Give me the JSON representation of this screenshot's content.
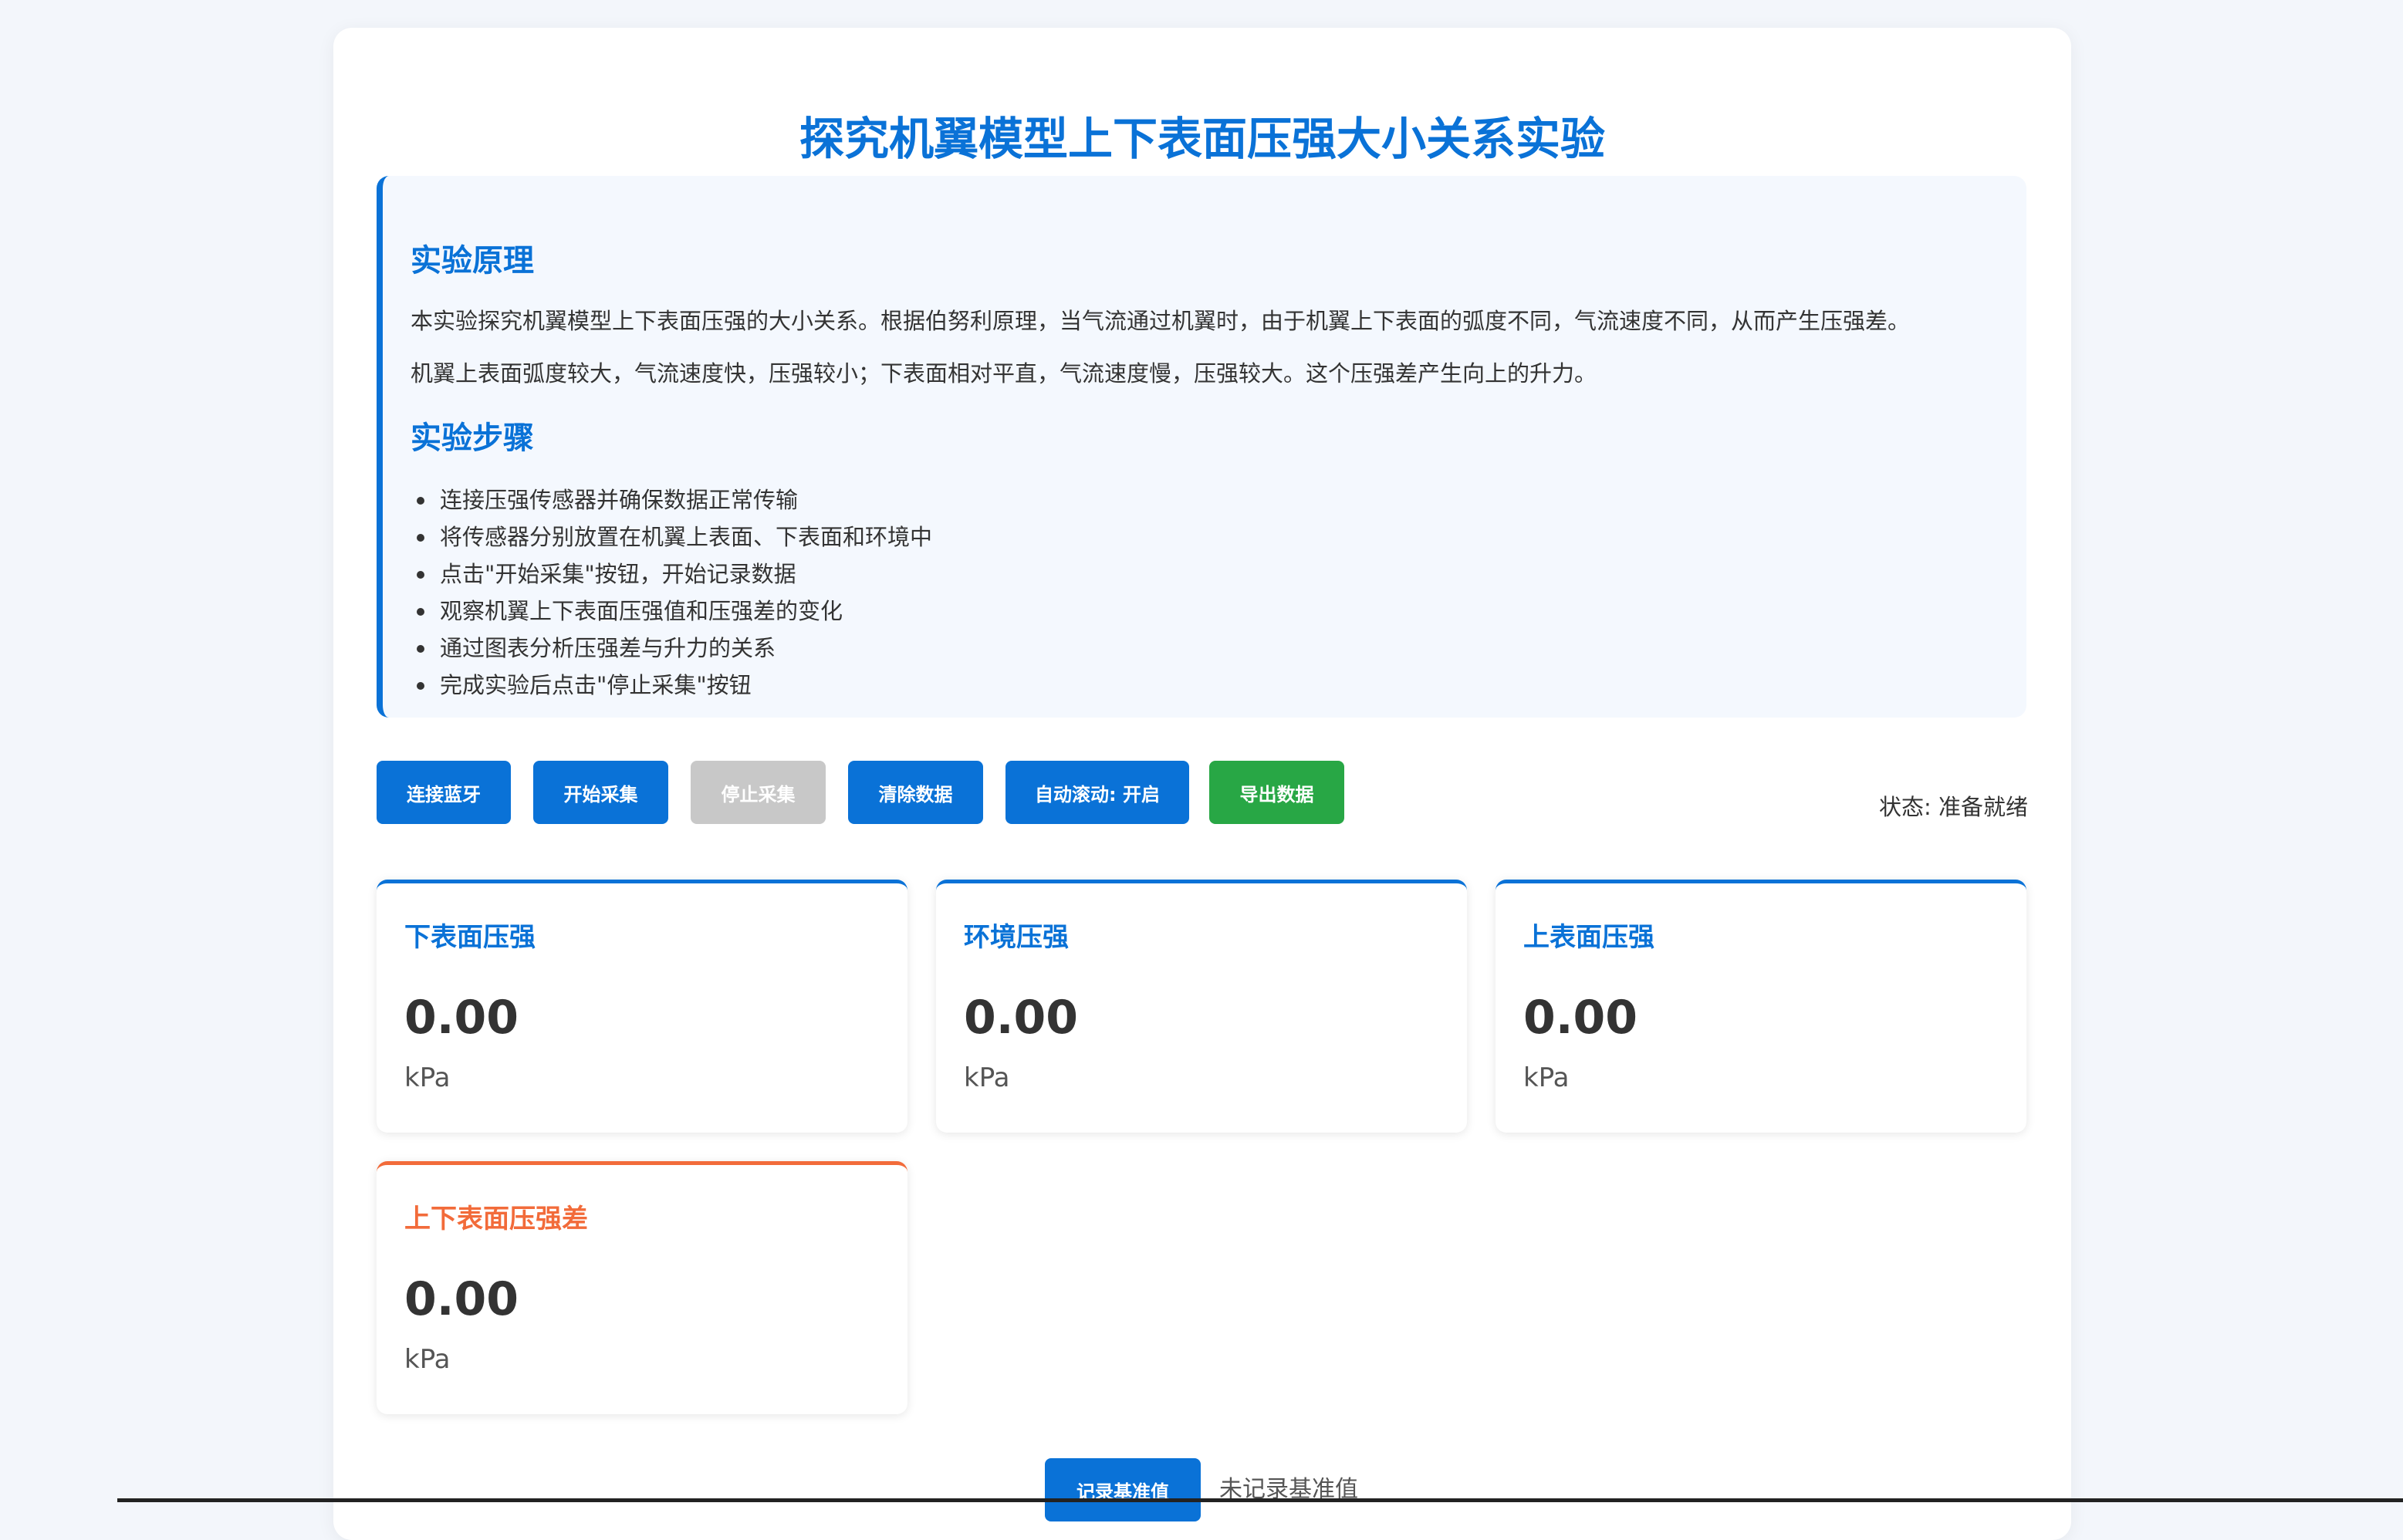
{
  "page": {
    "title": "探究机翼模型上下表面压强大小关系实验"
  },
  "principle": {
    "heading": "实验原理",
    "paragraphs": [
      "本实验探究机翼模型上下表面压强的大小关系。根据伯努利原理，当气流通过机翼时，由于机翼上下表面的弧度不同，气流速度不同，从而产生压强差。",
      "机翼上表面弧度较大，气流速度快，压强较小；下表面相对平直，气流速度慢，压强较大。这个压强差产生向上的升力。"
    ]
  },
  "steps": {
    "heading": "实验步骤",
    "items": [
      "连接压强传感器并确保数据正常传输",
      "将传感器分别放置在机翼上表面、下表面和环境中",
      "点击\"开始采集\"按钮，开始记录数据",
      "观察机翼上下表面压强值和压强差的变化",
      "通过图表分析压强差与升力的关系",
      "完成实验后点击\"停止采集\"按钮"
    ]
  },
  "toolbar": {
    "connect_bluetooth": "连接蓝牙",
    "start_collect": "开始采集",
    "stop_collect": "停止采集",
    "clear_data": "清除数据",
    "auto_scroll": "自动滚动: 开启",
    "export_data": "导出数据",
    "status": "状态: 准备就绪"
  },
  "cards": [
    {
      "title": "下表面压强",
      "value": "0.00",
      "unit": "kPa"
    },
    {
      "title": "环境压强",
      "value": "0.00",
      "unit": "kPa"
    },
    {
      "title": "上表面压强",
      "value": "0.00",
      "unit": "kPa"
    },
    {
      "title": "上下表面压强差",
      "value": "0.00",
      "unit": "kPa"
    }
  ],
  "baseline": {
    "button": "记录基准值",
    "status": "未记录基准值"
  },
  "colors": {
    "primary": "#0a72d7",
    "accent_orange": "#f26b3a",
    "export_green": "#28a745",
    "disabled_gray": "#c8c8c8",
    "panel_bg": "#f4f8fe",
    "page_bg": "#f3f6fb"
  }
}
